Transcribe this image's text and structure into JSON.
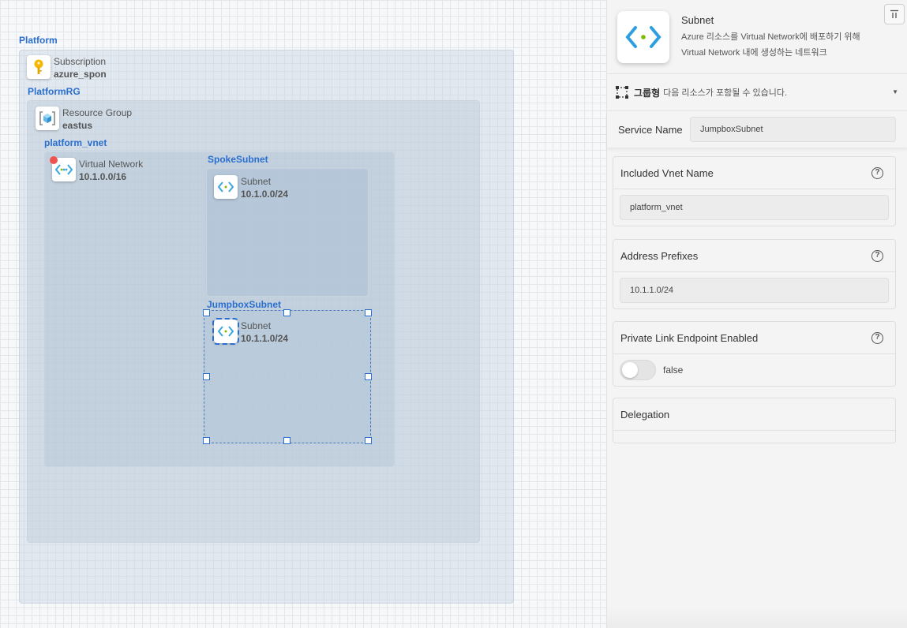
{
  "canvas": {
    "platform_label": "Platform",
    "subscription": {
      "title": "Subscription",
      "value": "azure_spon",
      "icon": "key-icon"
    },
    "platformrg_label": "PlatformRG",
    "resource_group": {
      "title": "Resource Group",
      "value": "eastus",
      "icon": "resource-group-icon"
    },
    "vnet_label": "platform_vnet",
    "virtual_network": {
      "title": "Virtual Network",
      "value": "10.1.0.0/16",
      "icon": "virtual-network-icon"
    },
    "spoke_label": "SpokeSubnet",
    "spoke_subnet": {
      "title": "Subnet",
      "value": "10.1.0.0/24",
      "icon": "subnet-icon"
    },
    "jump_label": "JumpboxSubnet",
    "jump_subnet": {
      "title": "Subnet",
      "value": "10.1.1.0/24",
      "icon": "subnet-icon"
    }
  },
  "panel": {
    "title": "Subnet",
    "description": "Azure 리소스를 Virtual Network에 배포하기 위해 Virtual Network 내에 생성하는 네트워크",
    "group_label": "그룹형",
    "group_desc": "다음 리소스가 포함될 수 있습니다.",
    "service_name_label": "Service Name",
    "service_name_value": "JumpboxSubnet",
    "vnet_name_label": "Included Vnet Name",
    "vnet_name_value": "platform_vnet",
    "prefixes_label": "Address Prefixes",
    "prefixes_value": "10.1.1.0/24",
    "private_link_label": "Private Link Endpoint Enabled",
    "private_link_value": "false",
    "delegation_label": "Delegation",
    "help_glyph": "?"
  },
  "colors": {
    "accent": "#2a6fcf",
    "alert": "#ef5350"
  }
}
